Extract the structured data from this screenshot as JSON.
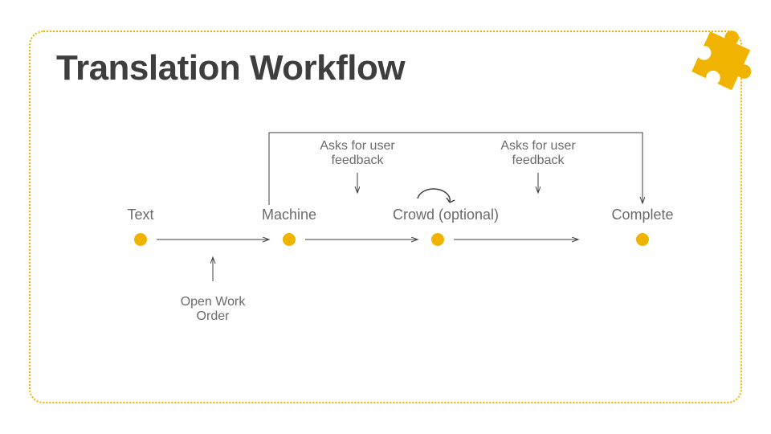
{
  "title": "Translation Workflow",
  "nodes": {
    "text": "Text",
    "machine": "Machine",
    "crowd": "Crowd (optional)",
    "complete": "Complete"
  },
  "annotations": {
    "feedback1_line1": "Asks for user",
    "feedback1_line2": "feedback",
    "feedback2_line1": "Asks for user",
    "feedback2_line2": "feedback",
    "open_work_line1": "Open Work",
    "open_work_line2": "Order"
  },
  "chart_data": {
    "type": "diagram",
    "title": "Translation Workflow",
    "nodes": [
      "Text",
      "Machine",
      "Crowd (optional)",
      "Complete"
    ],
    "edges": [
      {
        "from": "Text",
        "to": "Machine"
      },
      {
        "from": "Machine",
        "to": "Crowd (optional)"
      },
      {
        "from": "Crowd (optional)",
        "to": "Complete"
      },
      {
        "from": "Machine",
        "to": "Complete",
        "note": "bypass path"
      },
      {
        "from": "Crowd (optional)",
        "to": "Crowd (optional)",
        "note": "self-loop"
      }
    ],
    "annotations": [
      {
        "target_edge": [
          "Machine",
          "Crowd (optional)"
        ],
        "text": "Asks for user feedback"
      },
      {
        "target_edge": [
          "Crowd (optional)",
          "Complete"
        ],
        "text": "Asks for user feedback"
      },
      {
        "target_edge": [
          "Text",
          "Machine"
        ],
        "text": "Open Work Order"
      }
    ]
  }
}
